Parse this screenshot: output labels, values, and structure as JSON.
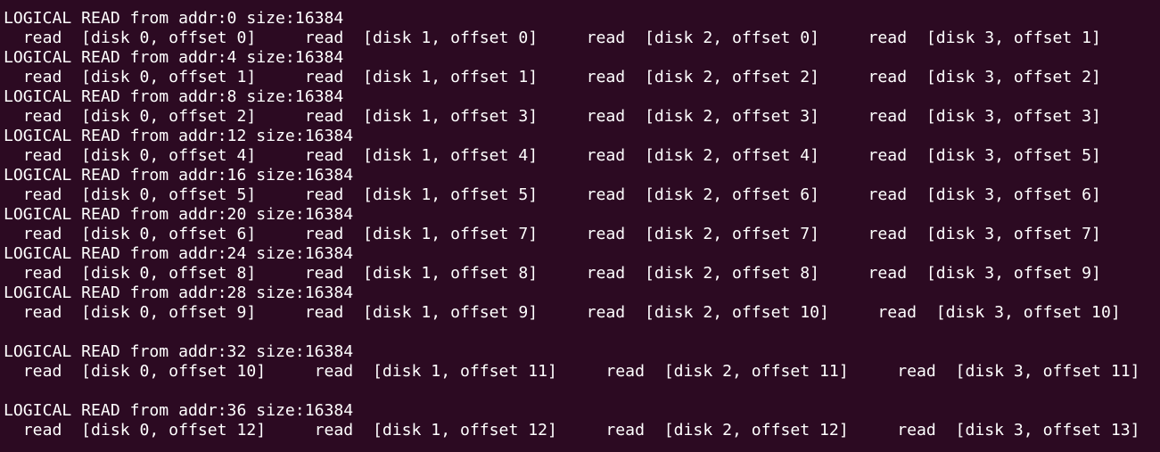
{
  "terminal": {
    "lines": [
      "LOGICAL READ from addr:0 size:16384",
      "  read  [disk 0, offset 0]     read  [disk 1, offset 0]     read  [disk 2, offset 0]     read  [disk 3, offset 1]",
      "LOGICAL READ from addr:4 size:16384",
      "  read  [disk 0, offset 1]     read  [disk 1, offset 1]     read  [disk 2, offset 2]     read  [disk 3, offset 2]",
      "LOGICAL READ from addr:8 size:16384",
      "  read  [disk 0, offset 2]     read  [disk 1, offset 3]     read  [disk 2, offset 3]     read  [disk 3, offset 3]",
      "LOGICAL READ from addr:12 size:16384",
      "  read  [disk 0, offset 4]     read  [disk 1, offset 4]     read  [disk 2, offset 4]     read  [disk 3, offset 5]",
      "LOGICAL READ from addr:16 size:16384",
      "  read  [disk 0, offset 5]     read  [disk 1, offset 5]     read  [disk 2, offset 6]     read  [disk 3, offset 6]",
      "LOGICAL READ from addr:20 size:16384",
      "  read  [disk 0, offset 6]     read  [disk 1, offset 7]     read  [disk 2, offset 7]     read  [disk 3, offset 7]",
      "LOGICAL READ from addr:24 size:16384",
      "  read  [disk 0, offset 8]     read  [disk 1, offset 8]     read  [disk 2, offset 8]     read  [disk 3, offset 9]",
      "LOGICAL READ from addr:28 size:16384",
      "  read  [disk 0, offset 9]     read  [disk 1, offset 9]     read  [disk 2, offset 10]     read  [disk 3, offset 10]",
      "",
      "LOGICAL READ from addr:32 size:16384",
      "  read  [disk 0, offset 10]     read  [disk 1, offset 11]     read  [disk 2, offset 11]     read  [disk 3, offset 11]",
      "",
      "LOGICAL READ from addr:36 size:16384",
      "  read  [disk 0, offset 12]     read  [disk 1, offset 12]     read  [disk 2, offset 12]     read  [disk 3, offset 13]"
    ]
  }
}
